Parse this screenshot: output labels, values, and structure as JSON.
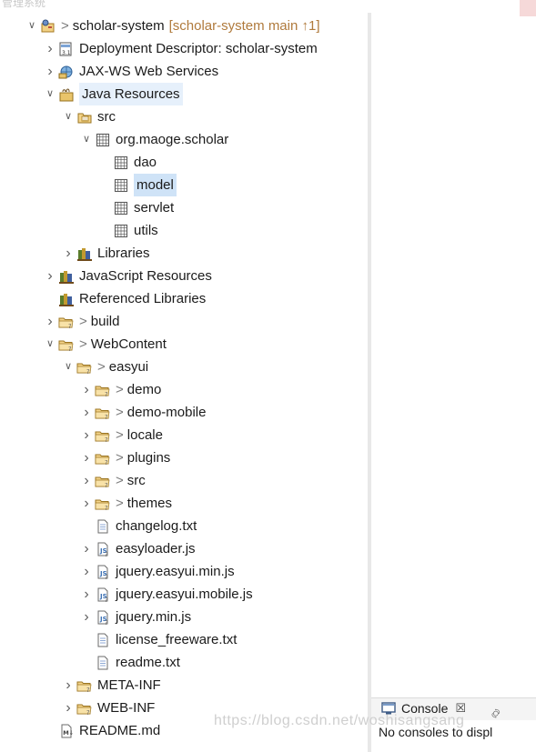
{
  "window_title_fragment": "管理系统",
  "tree": [
    {
      "level": 0,
      "arrow": "expanded",
      "icon": "project-icon",
      "decorator": ">",
      "label": "scholar-system",
      "extra": "[scholar-system main ↑1]"
    },
    {
      "level": 1,
      "arrow": "collapsed",
      "icon": "deployment-descriptor-icon",
      "label": "Deployment Descriptor: scholar-system"
    },
    {
      "level": 1,
      "arrow": "collapsed",
      "icon": "web-services-icon",
      "label": "JAX-WS Web Services"
    },
    {
      "level": 1,
      "arrow": "expanded",
      "icon": "java-resources-icon",
      "label": "Java Resources",
      "state": "hover"
    },
    {
      "level": 2,
      "arrow": "expanded",
      "icon": "source-folder-icon",
      "label": "src"
    },
    {
      "level": 3,
      "arrow": "expanded",
      "icon": "package-icon",
      "label": "org.maoge.scholar"
    },
    {
      "level": 4,
      "arrow": "none",
      "icon": "package-icon",
      "label": "dao"
    },
    {
      "level": 4,
      "arrow": "none",
      "icon": "package-icon",
      "label": "model",
      "state": "selected"
    },
    {
      "level": 4,
      "arrow": "none",
      "icon": "package-icon",
      "label": "servlet"
    },
    {
      "level": 4,
      "arrow": "none",
      "icon": "package-icon",
      "label": "utils"
    },
    {
      "level": 2,
      "arrow": "collapsed",
      "icon": "library-icon",
      "label": "Libraries"
    },
    {
      "level": 1,
      "arrow": "collapsed",
      "icon": "library-icon",
      "label": "JavaScript Resources"
    },
    {
      "level": 1,
      "arrow": "none",
      "icon": "library-icon",
      "label": "Referenced Libraries"
    },
    {
      "level": 1,
      "arrow": "collapsed",
      "icon": "folder-icon",
      "decorator": ">",
      "label": "build"
    },
    {
      "level": 1,
      "arrow": "expanded",
      "icon": "folder-icon",
      "decorator": ">",
      "label": "WebContent"
    },
    {
      "level": 2,
      "arrow": "expanded",
      "icon": "folder-icon",
      "decorator": ">",
      "label": "easyui"
    },
    {
      "level": 3,
      "arrow": "collapsed",
      "icon": "folder-icon",
      "decorator": ">",
      "label": "demo"
    },
    {
      "level": 3,
      "arrow": "collapsed",
      "icon": "folder-icon",
      "decorator": ">",
      "label": "demo-mobile"
    },
    {
      "level": 3,
      "arrow": "collapsed",
      "icon": "folder-icon",
      "decorator": ">",
      "label": "locale"
    },
    {
      "level": 3,
      "arrow": "collapsed",
      "icon": "folder-icon",
      "decorator": ">",
      "label": "plugins"
    },
    {
      "level": 3,
      "arrow": "collapsed",
      "icon": "folder-icon",
      "decorator": ">",
      "label": "src"
    },
    {
      "level": 3,
      "arrow": "collapsed",
      "icon": "folder-icon",
      "decorator": ">",
      "label": "themes"
    },
    {
      "level": 3,
      "arrow": "none",
      "icon": "text-file-icon",
      "label": "changelog.txt"
    },
    {
      "level": 3,
      "arrow": "collapsed",
      "icon": "js-file-icon",
      "label": "easyloader.js"
    },
    {
      "level": 3,
      "arrow": "collapsed",
      "icon": "js-file-icon",
      "label": "jquery.easyui.min.js"
    },
    {
      "level": 3,
      "arrow": "collapsed",
      "icon": "js-file-icon",
      "label": "jquery.easyui.mobile.js"
    },
    {
      "level": 3,
      "arrow": "collapsed",
      "icon": "js-file-icon",
      "label": "jquery.min.js"
    },
    {
      "level": 3,
      "arrow": "none",
      "icon": "text-file-icon",
      "label": "license_freeware.txt"
    },
    {
      "level": 3,
      "arrow": "none",
      "icon": "text-file-icon",
      "label": "readme.txt"
    },
    {
      "level": 2,
      "arrow": "collapsed",
      "icon": "folder-icon",
      "label": "META-INF"
    },
    {
      "level": 2,
      "arrow": "collapsed",
      "icon": "folder-icon",
      "label": "WEB-INF"
    },
    {
      "level": 1,
      "arrow": "none",
      "icon": "markdown-file-icon",
      "label": "README.md"
    }
  ],
  "console": {
    "tab_label": "Console",
    "close_symbol": "☒",
    "other_tab_symbol": "࿂ ",
    "message": "No consoles to displ"
  },
  "watermark": "https://blog.csdn.net/woshisangsang"
}
